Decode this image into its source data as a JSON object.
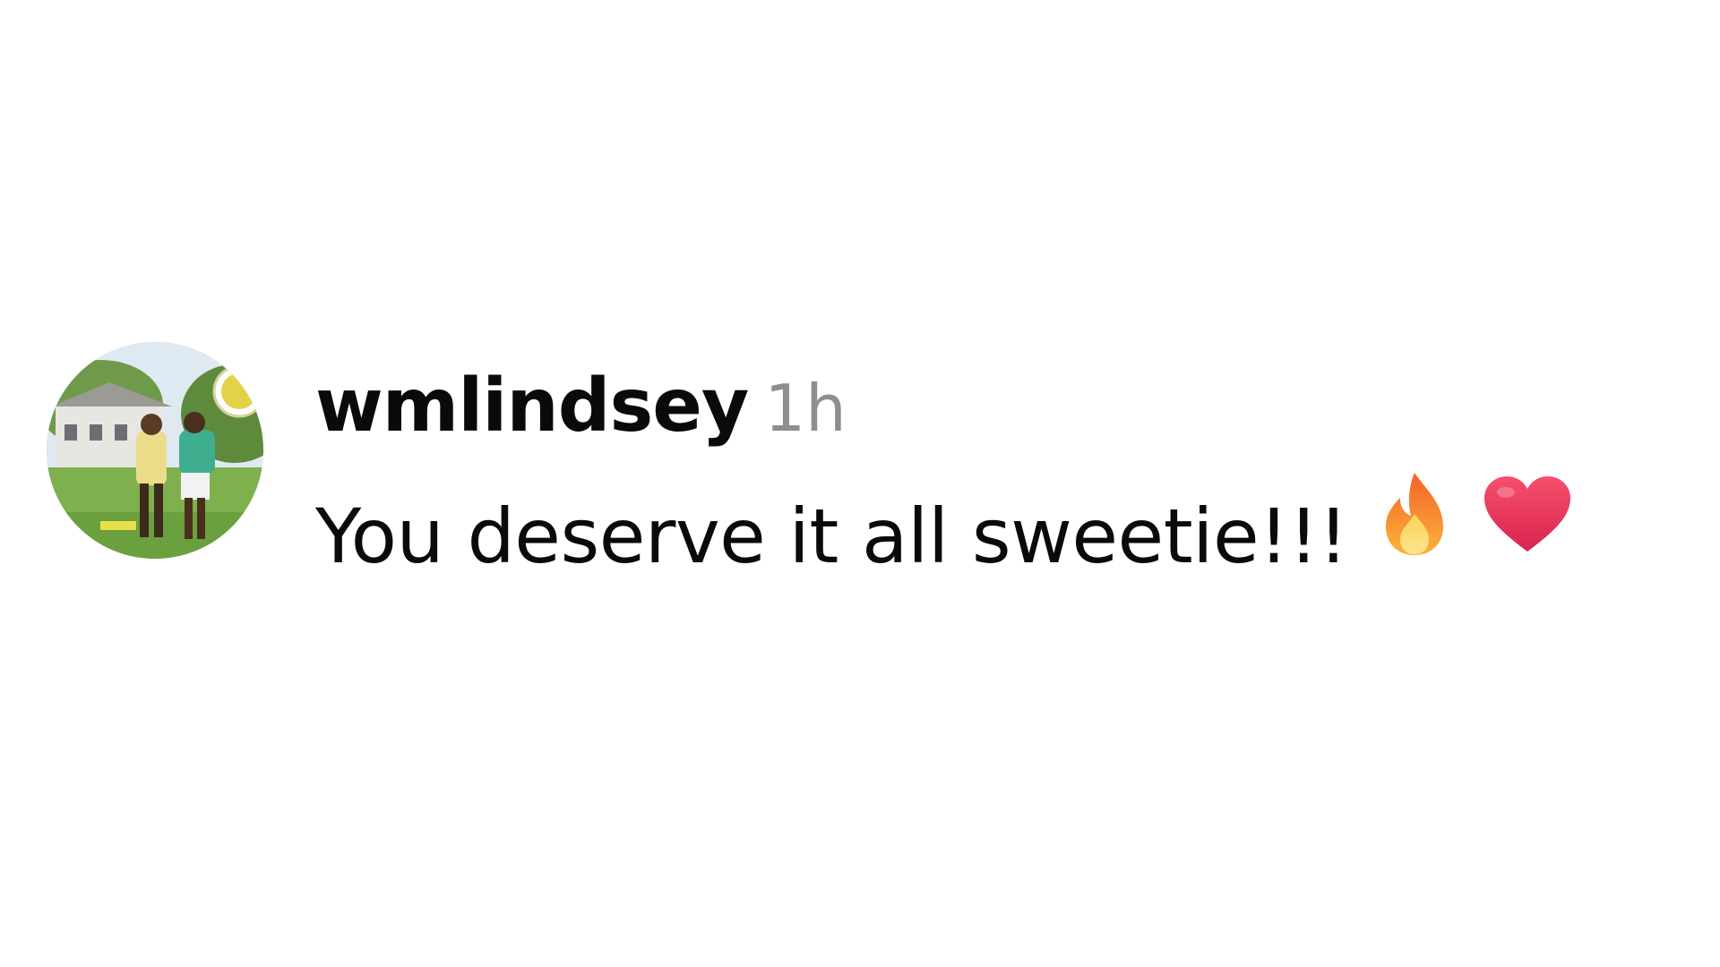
{
  "comment": {
    "avatar_icon": "user-avatar-photo",
    "username": "wmlindsey",
    "timestamp": "1h",
    "text": "You deserve it all sweetie!!!",
    "emojis": [
      "fire-emoji",
      "heart-emoji"
    ]
  },
  "colors": {
    "username": "#0a0a0a",
    "timestamp": "#8e8e8e",
    "text": "#0a0a0a",
    "heart": "#e8385f",
    "fire": "#f7912b"
  }
}
